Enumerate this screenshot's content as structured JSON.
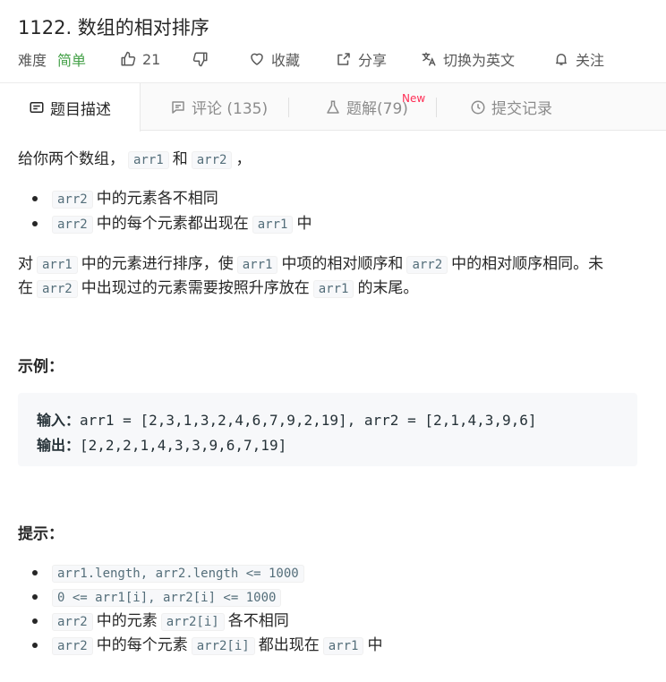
{
  "problem": {
    "title": "1122. 数组的相对排序",
    "difficulty_label": "难度",
    "difficulty": "简单",
    "likes": "21",
    "actions": {
      "favorite": "收藏",
      "share": "分享",
      "translate": "切换为英文",
      "follow": "关注"
    }
  },
  "tabs": [
    {
      "label": "题目描述"
    },
    {
      "label": "评论 (135)"
    },
    {
      "label": "题解(79)",
      "badge": "New"
    },
    {
      "label": "提交记录"
    }
  ],
  "description": {
    "intro": {
      "text1": "给你两个数组，",
      "code1": "arr1",
      "text2": "和",
      "code2": "arr2",
      "text3": "，"
    },
    "bullets": [
      {
        "code": "arr2",
        "text": "中的元素各不相同"
      },
      {
        "code": "arr2",
        "text": "中的每个元素都出现在",
        "code2": "arr1",
        "text2": "中"
      }
    ],
    "para": {
      "l1_a": "对",
      "l1_c1": "arr1",
      "l1_b": "中的元素进行排序，使",
      "l1_c2": "arr1",
      "l1_c": "中项的相对顺序和",
      "l1_c3": "arr2",
      "l1_d": "中的相对顺序相同。未",
      "l2_a": "在",
      "l2_c1": "arr2",
      "l2_b": "中出现过的元素需要按照升序放在",
      "l2_c2": "arr1",
      "l2_c": "的末尾。"
    },
    "example_heading": "示例：",
    "example": {
      "input_label": "输入：",
      "input": "arr1 = [2,3,1,3,2,4,6,7,9,2,19], arr2 = [2,1,4,3,9,6]",
      "output_label": "输出：",
      "output": "[2,2,2,1,4,3,3,9,6,7,19]"
    },
    "hints_heading": "提示：",
    "hints": [
      {
        "code": "arr1.length, arr2.length <= 1000"
      },
      {
        "code": "0 <= arr1[i], arr2[i] <= 1000"
      },
      {
        "code": "arr2",
        "text": "中的元素",
        "code2": "arr2[i]",
        "text2": "各不相同"
      },
      {
        "code": "arr2",
        "text": "中的每个元素",
        "code2": "arr2[i]",
        "text2": "都出现在",
        "code3": "arr1",
        "text3": "中"
      }
    ]
  }
}
